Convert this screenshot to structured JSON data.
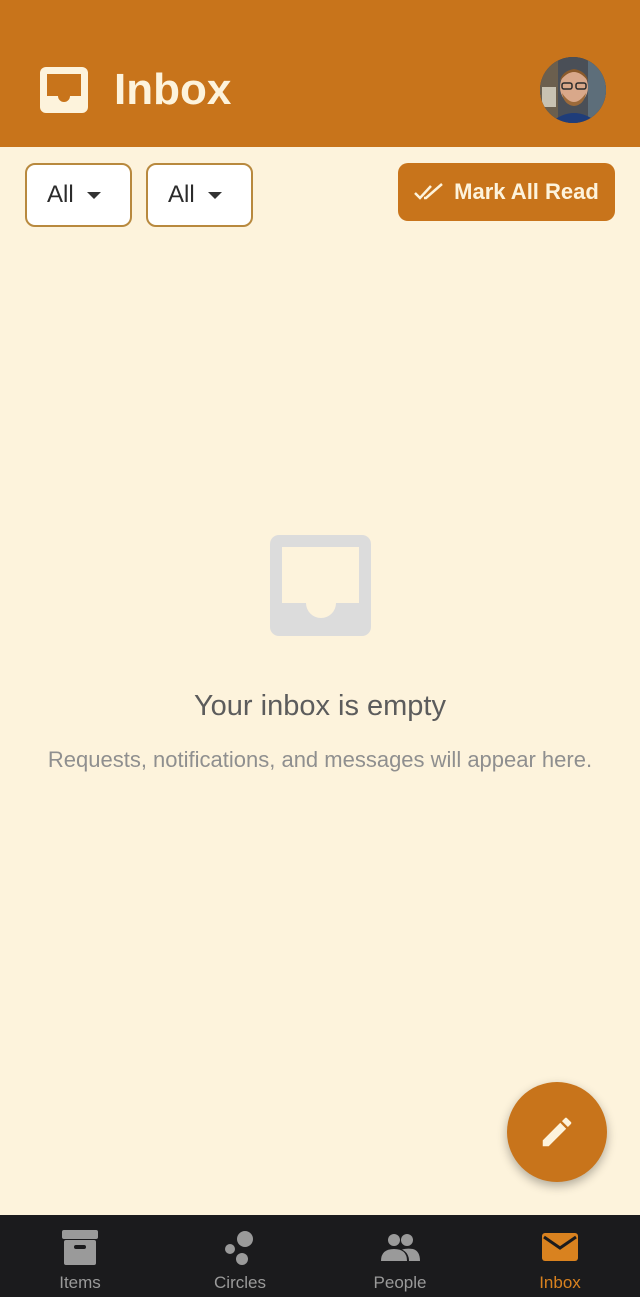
{
  "header": {
    "title": "Inbox",
    "icon": "inbox-icon",
    "avatar": "user-avatar"
  },
  "filters": {
    "filter_1": "All",
    "filter_2": "All",
    "mark_all_read": "Mark All Read"
  },
  "empty_state": {
    "icon": "inbox-icon",
    "headline": "Your inbox is empty",
    "subtext": "Requests, notifications, and messages will appear here."
  },
  "fab": {
    "icon": "pencil-icon"
  },
  "bottom_nav": {
    "items": [
      {
        "label": "Items",
        "icon": "archive-box-icon",
        "active": false
      },
      {
        "label": "Circles",
        "icon": "circles-icon",
        "active": false
      },
      {
        "label": "People",
        "icon": "people-icon",
        "active": false
      },
      {
        "label": "Inbox",
        "icon": "envelope-icon",
        "active": true
      }
    ]
  },
  "colors": {
    "primary": "#c8741b",
    "background": "#fdf3dc",
    "nav_background": "#1b1b1d",
    "nav_active": "#d9821f",
    "nav_inactive": "#9a9a9a"
  }
}
